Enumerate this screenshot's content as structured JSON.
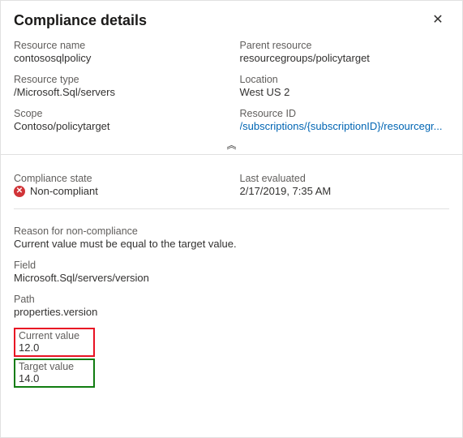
{
  "header": {
    "title": "Compliance details"
  },
  "props": {
    "resourceName": {
      "label": "Resource name",
      "value": "contososqlpolicy"
    },
    "parentResource": {
      "label": "Parent resource",
      "value": "resourcegroups/policytarget"
    },
    "resourceType": {
      "label": "Resource type",
      "value": "/Microsoft.Sql/servers"
    },
    "location": {
      "label": "Location",
      "value": "West US 2"
    },
    "scope": {
      "label": "Scope",
      "value": "Contoso/policytarget"
    },
    "resourceId": {
      "label": "Resource ID",
      "value": "/subscriptions/{subscriptionID}/resourcegr..."
    }
  },
  "status": {
    "complianceStateLabel": "Compliance state",
    "complianceStateValue": "Non-compliant",
    "lastEvaluatedLabel": "Last evaluated",
    "lastEvaluatedValue": "2/17/2019, 7:35 AM"
  },
  "reason": {
    "reasonLabel": "Reason for non-compliance",
    "reasonValue": "Current value must be equal to the target value.",
    "fieldLabel": "Field",
    "fieldValue": "Microsoft.Sql/servers/version",
    "pathLabel": "Path",
    "pathValue": "properties.version",
    "currentLabel": "Current value",
    "currentValue": "12.0",
    "targetLabel": "Target value",
    "targetValue": "14.0"
  },
  "icons": {
    "close": "✕",
    "error": "✕",
    "chevronUp": "︽"
  }
}
